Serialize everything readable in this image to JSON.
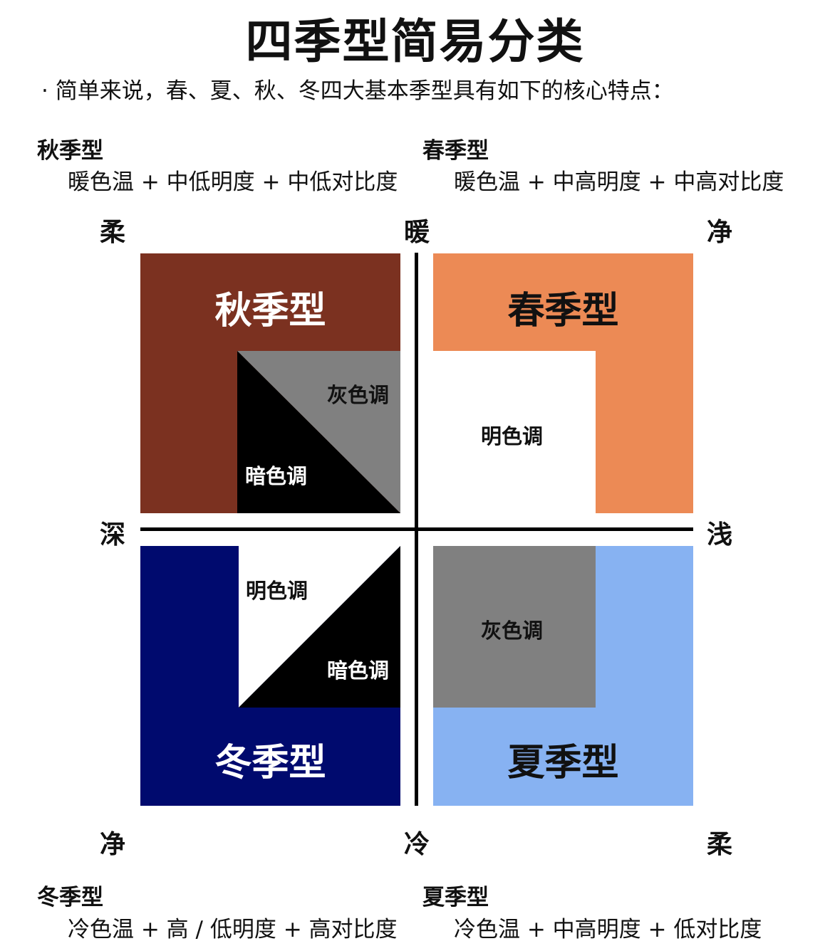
{
  "title": "四季型简易分类",
  "subtitle": "· 简单来说，春、夏、秋、冬四大基本季型具有如下的核心特点：",
  "sections": {
    "autumn": {
      "name": "秋季型",
      "desc": "暖色温 + 中低明度 + 中低对比度"
    },
    "spring": {
      "name": "春季型",
      "desc": "暖色温 + 中高明度 + 中高对比度"
    },
    "winter": {
      "name": "冬季型",
      "desc": "冷色温 + 高 / 低明度 + 高对比度"
    },
    "summer": {
      "name": "夏季型",
      "desc": "冷色温 + 中高明度 + 低对比度"
    }
  },
  "axes": {
    "top_left": "柔",
    "top": "暖",
    "top_right": "净",
    "left": "深",
    "right": "浅",
    "bottom_left": "净",
    "bottom": "冷",
    "bottom_right": "柔"
  },
  "quadrants": {
    "autumn": {
      "label": "秋季型",
      "color": "#7B3120",
      "tones": [
        "灰色调",
        "暗色调"
      ]
    },
    "spring": {
      "label": "春季型",
      "color": "#EC8A55",
      "tones": [
        "明色调"
      ]
    },
    "winter": {
      "label": "冬季型",
      "color": "#000A6E",
      "tones": [
        "明色调",
        "暗色调"
      ]
    },
    "summer": {
      "label": "夏季型",
      "color": "#87B2F2",
      "tones": [
        "灰色调"
      ]
    }
  },
  "colors": {
    "gray": "#808080",
    "black": "#000000",
    "white": "#ffffff"
  }
}
